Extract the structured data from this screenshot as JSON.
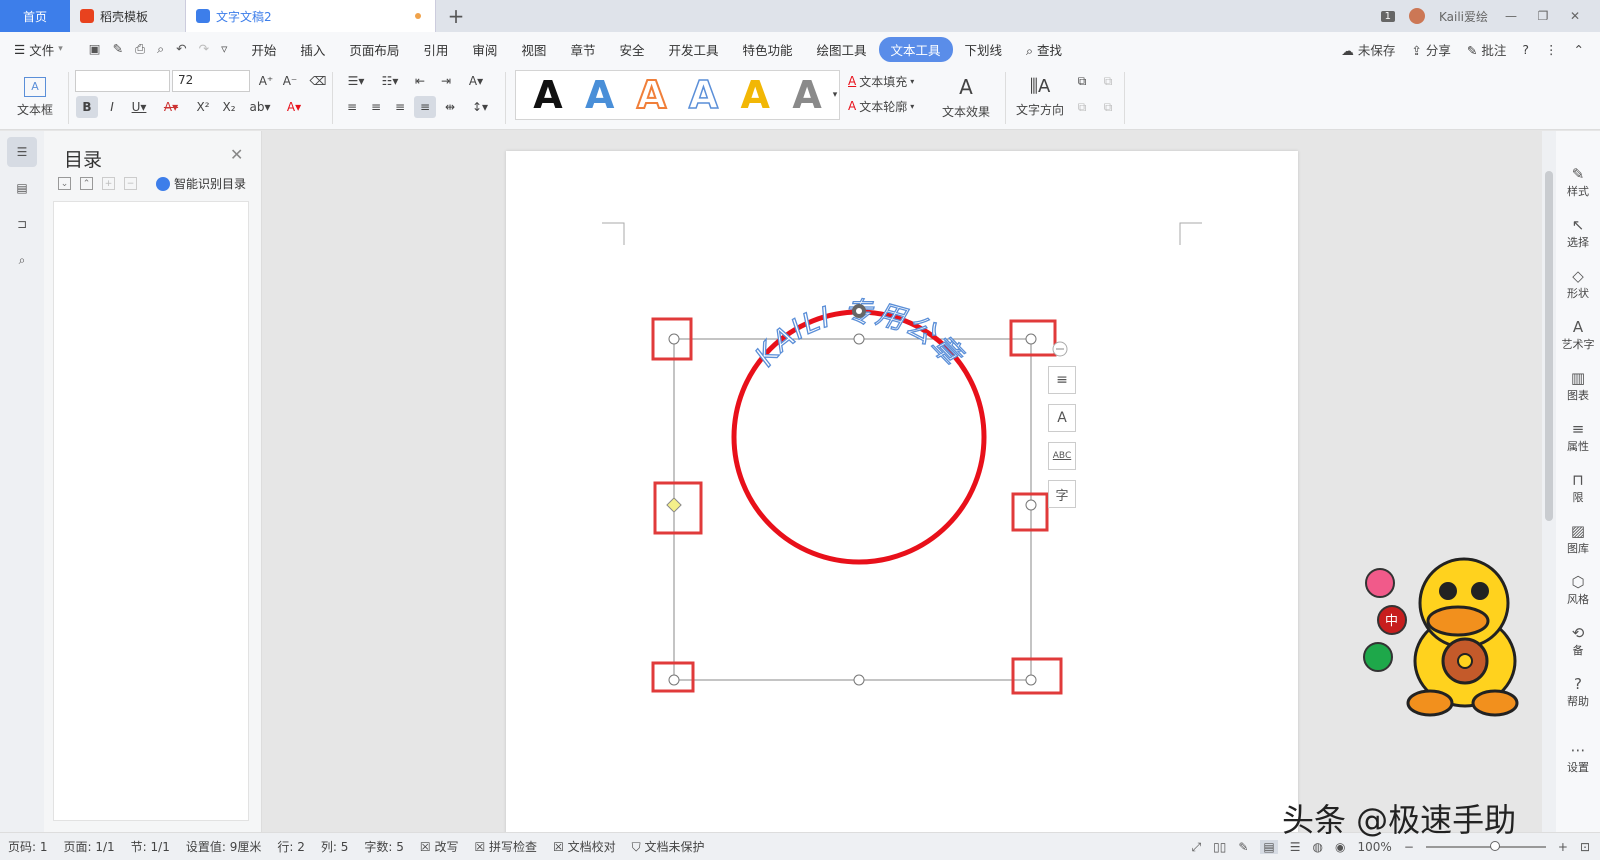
{
  "tabs": {
    "home": "首页",
    "template": "稻壳模板",
    "doc": "文字文稿2",
    "badge": "1",
    "user": "Kaili爱绘"
  },
  "menu": {
    "file": "文件",
    "items": [
      "开始",
      "插入",
      "页面布局",
      "引用",
      "审阅",
      "视图",
      "章节",
      "安全",
      "开发工具",
      "特色功能",
      "绘图工具",
      "文本工具",
      "下划线"
    ],
    "search": "查找",
    "unsaved": "未保存",
    "share": "分享",
    "comment": "批注"
  },
  "ribbon": {
    "textbox": "文本框",
    "font_size": "72",
    "fill": "文本填充",
    "outline": "文本轮廓",
    "effect": "文本效果",
    "direction": "文字方向",
    "gallery": [
      "A",
      "A",
      "A",
      "A",
      "A",
      "A"
    ],
    "gallery_colors": [
      "#111111",
      "#4a8fd8",
      "#f07f3a",
      "#5b8fd8",
      "#f2b705",
      "#8a8a8a"
    ]
  },
  "toc": {
    "title": "目录",
    "smart": "智能识别目录"
  },
  "stamp": {
    "text": "KAILI 专用公章",
    "ring_color": "#e8101a",
    "text_color": "#5b8fd8"
  },
  "float_tools": [
    "≡",
    "A",
    "ABC",
    "字"
  ],
  "right_panel": [
    "样式",
    "选择",
    "形状",
    "艺术字",
    "图表",
    "属性",
    "限",
    "图库",
    "风格",
    "备",
    "帮助",
    "设置"
  ],
  "status": {
    "page_num": "页码: 1",
    "pages": "页面: 1/1",
    "section": "节: 1/1",
    "setting": "设置值: 9厘米",
    "row": "行: 2",
    "col": "列: 5",
    "words": "字数: 5",
    "revise": "改写",
    "spell": "拼写检查",
    "proof": "文档校对",
    "protect": "文档未保护",
    "zoom": "100%"
  },
  "watermark": "头条 @极速手助"
}
